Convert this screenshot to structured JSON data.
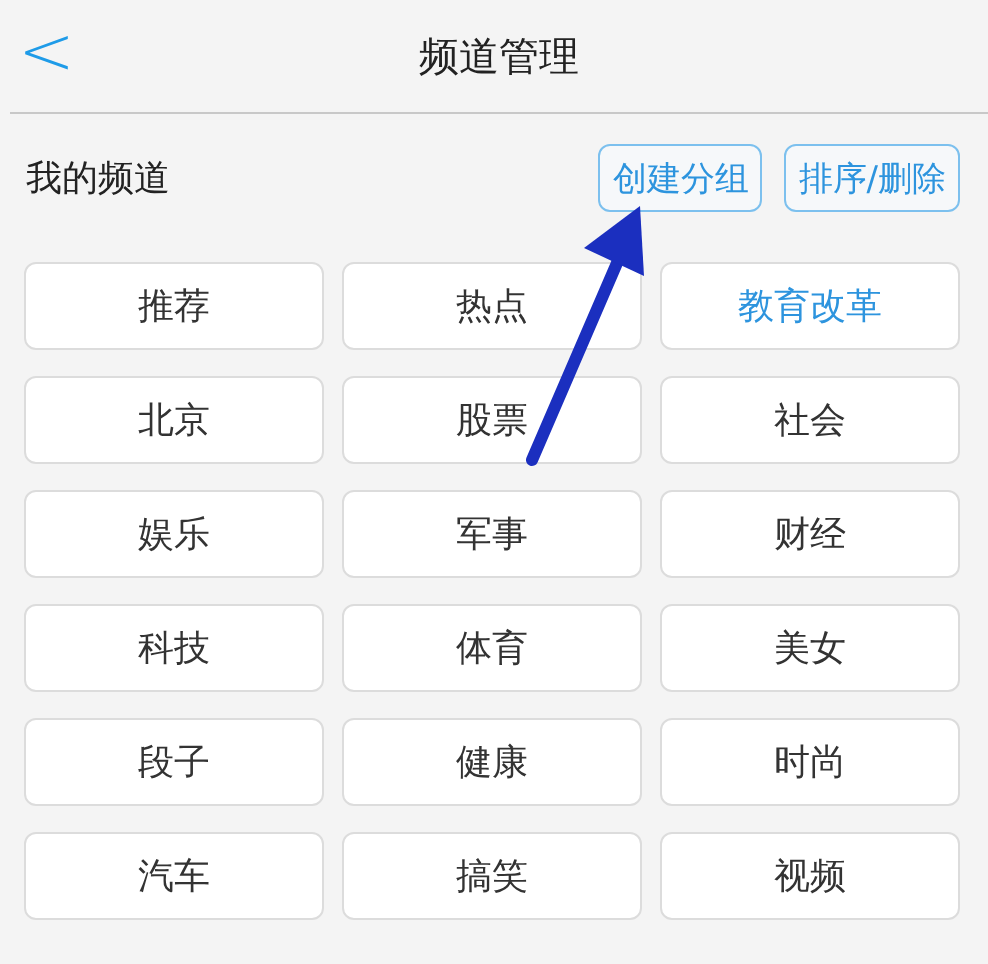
{
  "header": {
    "back": "<",
    "title": "频道管理"
  },
  "section": {
    "title": "我的频道",
    "buttons": [
      "创建分组",
      "排序/删除"
    ]
  },
  "channels": [
    {
      "label": "推荐",
      "selected": false
    },
    {
      "label": "热点",
      "selected": false
    },
    {
      "label": "教育改革",
      "selected": true
    },
    {
      "label": "北京",
      "selected": false
    },
    {
      "label": "股票",
      "selected": false
    },
    {
      "label": "社会",
      "selected": false
    },
    {
      "label": "娱乐",
      "selected": false
    },
    {
      "label": "军事",
      "selected": false
    },
    {
      "label": "财经",
      "selected": false
    },
    {
      "label": "科技",
      "selected": false
    },
    {
      "label": "体育",
      "selected": false
    },
    {
      "label": "美女",
      "selected": false
    },
    {
      "label": "段子",
      "selected": false
    },
    {
      "label": "健康",
      "selected": false
    },
    {
      "label": "时尚",
      "selected": false
    },
    {
      "label": "汽车",
      "selected": false
    },
    {
      "label": "搞笑",
      "selected": false
    },
    {
      "label": "视频",
      "selected": false
    }
  ]
}
